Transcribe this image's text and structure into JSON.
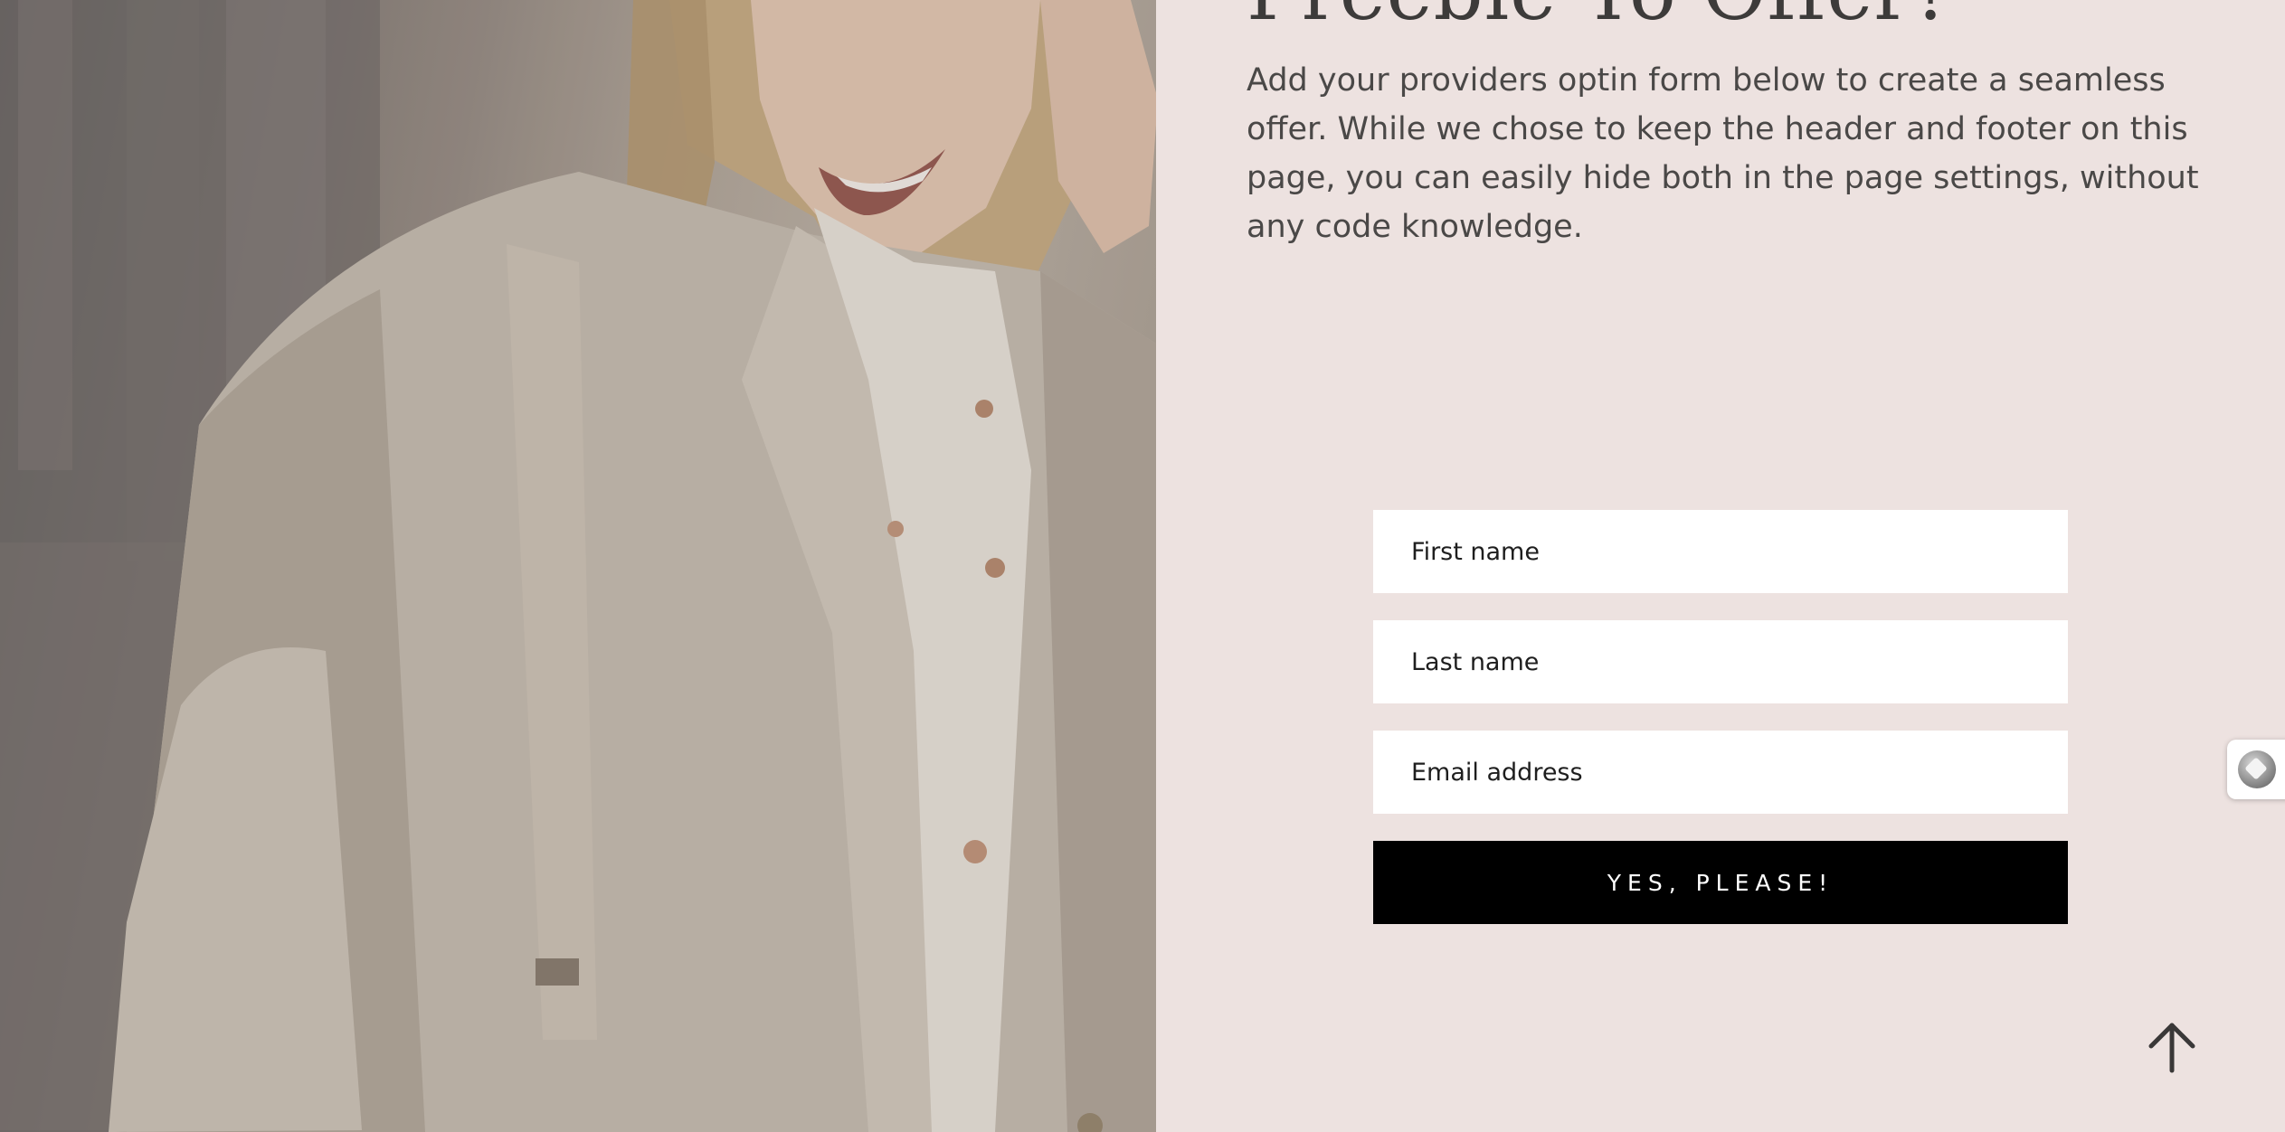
{
  "hero": {
    "heading": "Freebie To Offer?",
    "description": "Add your providers optin form below to create a seamless offer. While we chose to keep the header and footer on this page, you can easily hide both in the page settings, without any code knowledge."
  },
  "form": {
    "first_name_placeholder": "First name",
    "last_name_placeholder": "Last name",
    "email_placeholder": "Email address",
    "submit_label": "YES, PLEASE!"
  },
  "icons": {
    "back_to_top": "arrow-up-icon",
    "side_widget": "accessibility-widget-icon"
  },
  "colors": {
    "background": "#ede2e0",
    "button": "#000000",
    "button_text": "#ffffff",
    "text": "#4a4847"
  }
}
